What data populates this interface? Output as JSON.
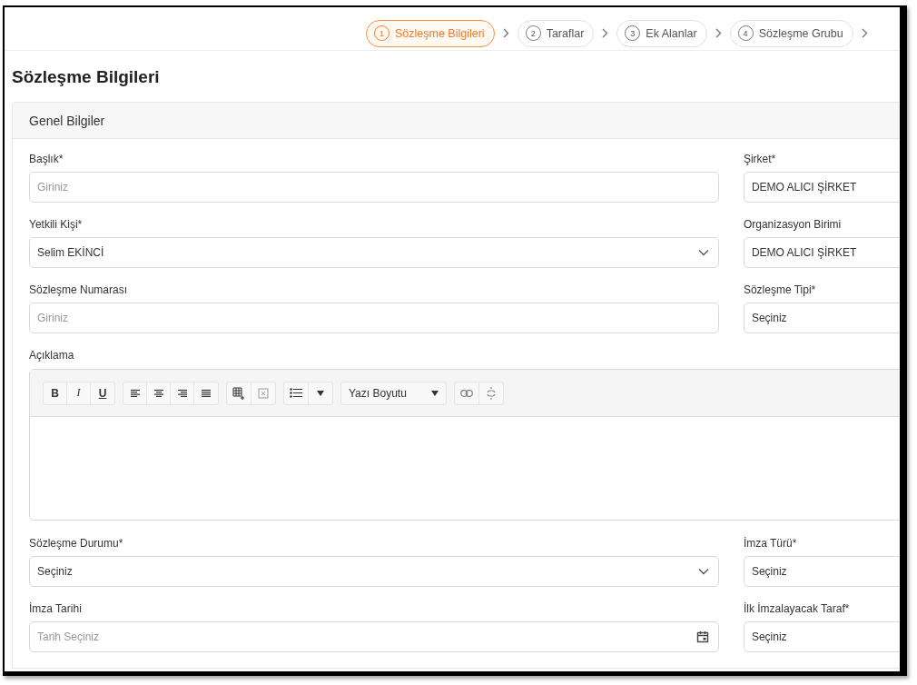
{
  "steps": [
    {
      "number": "1",
      "label": "Sözleşme Bilgileri",
      "selected": true
    },
    {
      "number": "2",
      "label": "Taraflar",
      "selected": false
    },
    {
      "number": "3",
      "label": "Ek Alanlar",
      "selected": false
    },
    {
      "number": "4",
      "label": "Sözleşme Grubu",
      "selected": false
    }
  ],
  "page_title": "Sözleşme Bilgileri",
  "section_title": "Genel Bilgiler",
  "rows": [
    {
      "kind": "pair",
      "left": {
        "label": "Başlık*",
        "kind": "text",
        "placeholder": "Giriniz"
      },
      "right": {
        "label": "Şirket*",
        "kind": "text",
        "value": "DEMO ALICI ŞİRKET"
      }
    },
    {
      "kind": "pair",
      "left": {
        "label": "Yetkili Kişi*",
        "kind": "select",
        "value": "Selim EKİNCİ"
      },
      "right": {
        "label": "Organizasyon Birimi",
        "kind": "text",
        "value": "DEMO ALICI ŞİRKET"
      }
    },
    {
      "kind": "pair",
      "left": {
        "label": "Sözleşme Numarası",
        "kind": "text",
        "placeholder": "Giriniz"
      },
      "right": {
        "label": "Sözleşme Tipi*",
        "kind": "text",
        "value": "Seçiniz"
      }
    },
    {
      "kind": "editor",
      "label": "Açıklama",
      "toolbar": [
        [
          {
            "kind": "bold",
            "text": "B"
          },
          {
            "kind": "italic",
            "text": "I"
          },
          {
            "kind": "underline",
            "text": "U"
          }
        ],
        [
          {
            "kind": "alignleft"
          },
          {
            "kind": "aligncenter"
          },
          {
            "kind": "alignright"
          },
          {
            "kind": "justify"
          }
        ],
        [
          {
            "kind": "table"
          },
          {
            "kind": "cells"
          }
        ],
        [
          {
            "kind": "list"
          },
          {
            "kind": "caret"
          }
        ],
        [
          {
            "kind": "dropdown",
            "text": "Yazı Boyutu"
          }
        ],
        [
          {
            "kind": "link"
          },
          {
            "kind": "unlink"
          }
        ]
      ]
    },
    {
      "kind": "pair",
      "left": {
        "label": "Sözleşme Durumu*",
        "kind": "select",
        "value": "Seçiniz"
      },
      "right": {
        "label": "İmza Türü*",
        "kind": "text",
        "value": "Seçiniz"
      }
    },
    {
      "kind": "pair",
      "left": {
        "label": "İmza Tarihi",
        "kind": "date",
        "placeholder": "Tarih Seçiniz"
      },
      "right": {
        "label": "İlk İmzalayacak Taraf*",
        "kind": "text",
        "value": "Seçiniz"
      }
    }
  ]
}
